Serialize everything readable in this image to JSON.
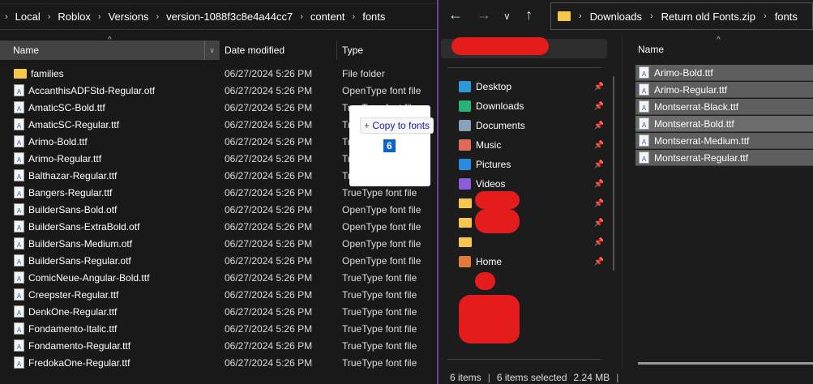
{
  "left": {
    "breadcrumb": [
      "Local",
      "Roblox",
      "Versions",
      "version-1088f3c8e4a44cc7",
      "content",
      "fonts"
    ],
    "columns": {
      "name": "Name",
      "date": "Date modified",
      "type": "Type"
    },
    "files": [
      {
        "name": "families",
        "date": "06/27/2024 5:26 PM",
        "type": "File folder",
        "icon": "folder"
      },
      {
        "name": "AccanthisADFStd-Regular.otf",
        "date": "06/27/2024 5:26 PM",
        "type": "OpenType font file",
        "icon": "font"
      },
      {
        "name": "AmaticSC-Bold.ttf",
        "date": "06/27/2024 5:26 PM",
        "type": "TrueType font file",
        "icon": "font"
      },
      {
        "name": "AmaticSC-Regular.ttf",
        "date": "06/27/2024 5:26 PM",
        "type": "TrueType font file",
        "icon": "font"
      },
      {
        "name": "Arimo-Bold.ttf",
        "date": "06/27/2024 5:26 PM",
        "type": "TrueType font file",
        "icon": "font"
      },
      {
        "name": "Arimo-Regular.ttf",
        "date": "06/27/2024 5:26 PM",
        "type": "TrueType font file",
        "icon": "font"
      },
      {
        "name": "Balthazar-Regular.ttf",
        "date": "06/27/2024 5:26 PM",
        "type": "TrueType font file",
        "icon": "font"
      },
      {
        "name": "Bangers-Regular.ttf",
        "date": "06/27/2024 5:26 PM",
        "type": "TrueType font file",
        "icon": "font"
      },
      {
        "name": "BuilderSans-Bold.otf",
        "date": "06/27/2024 5:26 PM",
        "type": "OpenType font file",
        "icon": "font"
      },
      {
        "name": "BuilderSans-ExtraBold.otf",
        "date": "06/27/2024 5:26 PM",
        "type": "OpenType font file",
        "icon": "font"
      },
      {
        "name": "BuilderSans-Medium.otf",
        "date": "06/27/2024 5:26 PM",
        "type": "OpenType font file",
        "icon": "font"
      },
      {
        "name": "BuilderSans-Regular.otf",
        "date": "06/27/2024 5:26 PM",
        "type": "OpenType font file",
        "icon": "font"
      },
      {
        "name": "ComicNeue-Angular-Bold.ttf",
        "date": "06/27/2024 5:26 PM",
        "type": "TrueType font file",
        "icon": "font"
      },
      {
        "name": "Creepster-Regular.ttf",
        "date": "06/27/2024 5:26 PM",
        "type": "TrueType font file",
        "icon": "font"
      },
      {
        "name": "DenkOne-Regular.ttf",
        "date": "06/27/2024 5:26 PM",
        "type": "TrueType font file",
        "icon": "font"
      },
      {
        "name": "Fondamento-Italic.ttf",
        "date": "06/27/2024 5:26 PM",
        "type": "TrueType font file",
        "icon": "font"
      },
      {
        "name": "Fondamento-Regular.ttf",
        "date": "06/27/2024 5:26 PM",
        "type": "TrueType font file",
        "icon": "font"
      },
      {
        "name": "FredokaOne-Regular.ttf",
        "date": "06/27/2024 5:26 PM",
        "type": "TrueType font file",
        "icon": "font"
      }
    ]
  },
  "drag": {
    "label": "Copy to fonts",
    "count": "6"
  },
  "right": {
    "breadcrumb": [
      "Downloads",
      "Return old Fonts.zip",
      "fonts"
    ],
    "sidebar": [
      {
        "label": "Desktop",
        "color": "#2a9ad8"
      },
      {
        "label": "Downloads",
        "color": "#2bb07a"
      },
      {
        "label": "Documents",
        "color": "#8aa0b8"
      },
      {
        "label": "Music",
        "color": "#e06a5a"
      },
      {
        "label": "Pictures",
        "color": "#2a8ae0"
      },
      {
        "label": "Videos",
        "color": "#8b5cd6"
      }
    ],
    "home": "Home",
    "column_name": "Name",
    "files": [
      "Arimo-Bold.ttf",
      "Arimo-Regular.ttf",
      "Montserrat-Black.ttf",
      "Montserrat-Bold.ttf",
      "Montserrat-Medium.ttf",
      "Montserrat-Regular.ttf"
    ],
    "status": {
      "items": "6 items",
      "selected": "6 items selected",
      "size": "2.24 MB"
    }
  }
}
